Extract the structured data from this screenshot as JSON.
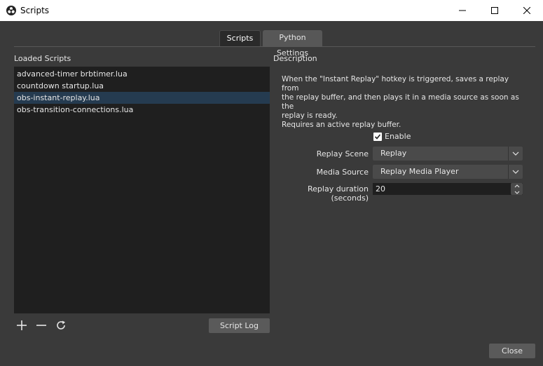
{
  "window": {
    "title": "Scripts",
    "icon": "obs-logo-icon"
  },
  "tabs": [
    {
      "label": "Scripts",
      "active": true
    },
    {
      "label": "Python Settings",
      "active": false
    }
  ],
  "left": {
    "label": "Loaded Scripts",
    "scripts": [
      "advanced-timer brbtimer.lua",
      "countdown startup.lua",
      "obs-instant-replay.lua",
      "obs-transition-connections.lua"
    ],
    "selected_index": 2,
    "icons": [
      "plus-icon",
      "minus-icon",
      "reload-icon"
    ],
    "script_log_label": "Script Log"
  },
  "right": {
    "label": "Description",
    "description_lines": [
      "When the \"Instant Replay\" hotkey is triggered, saves a replay from",
      "the replay buffer, and then plays it in a media source as soon as the",
      "replay is ready.",
      "Requires an active replay buffer."
    ],
    "enable": {
      "label": "Enable",
      "checked": true
    },
    "replay_scene": {
      "label": "Replay Scene",
      "value": "Replay"
    },
    "media_source": {
      "label": "Media Source",
      "value": "Replay Media Player"
    },
    "replay_duration": {
      "label": "Replay duration (seconds)",
      "value": "20"
    }
  },
  "footer": {
    "close_label": "Close"
  },
  "colors": {
    "background": "#3a3a3a",
    "list_background": "#1f1f1f",
    "selection": "#253b50",
    "button": "#5a5a5a"
  }
}
